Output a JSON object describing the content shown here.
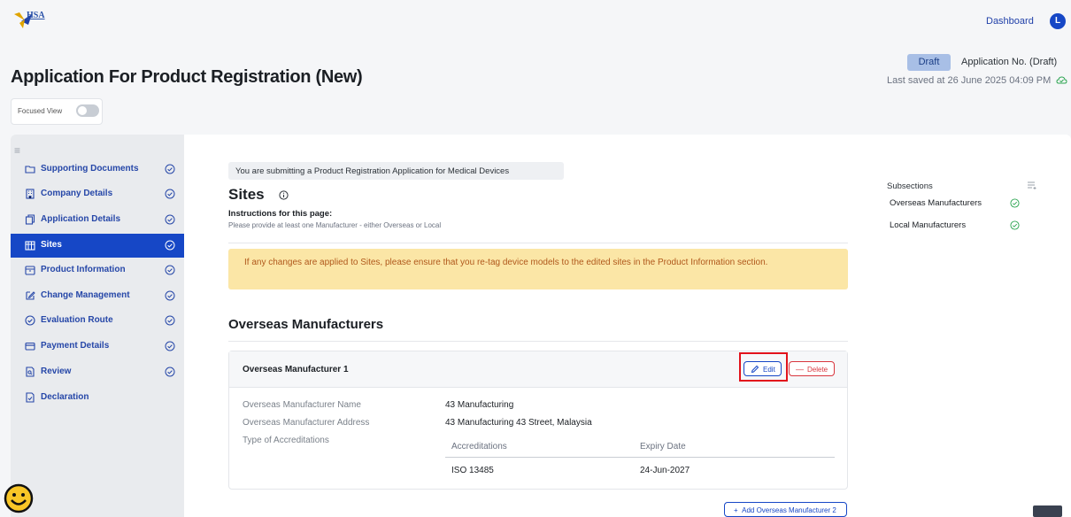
{
  "header": {
    "logo_text": "HSA",
    "dashboard_link": "Dashboard",
    "avatar_initial": "L",
    "page_title": "Application For Product Registration (New)",
    "status_badge": "Draft",
    "application_no": "Application No. (Draft)",
    "last_saved": "Last saved at 26 June 2025 04:09 PM",
    "focused_view_label": "Focused View",
    "focused_view_on": false
  },
  "sidebar": {
    "items": [
      {
        "label": "Supporting Documents",
        "icon": "folder-icon",
        "done": true
      },
      {
        "label": "Company Details",
        "icon": "building-icon",
        "done": true
      },
      {
        "label": "Application Details",
        "icon": "copy-icon",
        "done": true
      },
      {
        "label": "Sites",
        "icon": "sites-icon",
        "done": true,
        "active": true
      },
      {
        "label": "Product Information",
        "icon": "box-icon",
        "done": true
      },
      {
        "label": "Change Management",
        "icon": "edit-icon",
        "done": true
      },
      {
        "label": "Evaluation Route",
        "icon": "check-circle-icon",
        "done": true
      },
      {
        "label": "Payment Details",
        "icon": "card-icon",
        "done": true
      },
      {
        "label": "Review",
        "icon": "review-icon",
        "done": true
      },
      {
        "label": "Declaration",
        "icon": "document-icon",
        "done": false
      }
    ]
  },
  "main": {
    "notice": "You are submitting a Product Registration Application for Medical Devices",
    "title": "Sites",
    "instructions_title": "Instructions for this page:",
    "instructions_text": "Please provide at least one Manufacturer - either Overseas or Local",
    "warning_text": "If any changes are applied to Sites, please ensure that you re-tag device models to the edited sites in the Product Information section.",
    "section_title": "Overseas Manufacturers",
    "card": {
      "title": "Overseas Manufacturer 1",
      "edit_label": "Edit",
      "delete_label": "Delete",
      "fields": [
        {
          "key": "Overseas Manufacturer Name",
          "value": "43 Manufacturing"
        },
        {
          "key": "Overseas Manufacturer Address",
          "value": "43 Manufacturing 43 Street, Malaysia"
        },
        {
          "key": "Type of Accreditations",
          "value": ""
        }
      ],
      "accreditations": {
        "headers": [
          "Accreditations",
          "Expiry Date"
        ],
        "rows": [
          [
            "ISO 13485",
            "24-Jun-2027"
          ]
        ]
      }
    },
    "add_button": "Add Overseas Manufacturer 2"
  },
  "subsections": {
    "title": "Subsections",
    "items": [
      {
        "label": "Overseas Manufacturers",
        "done": true
      },
      {
        "label": "Local Manufacturers",
        "done": true
      }
    ]
  },
  "colors": {
    "primary": "#1647c6",
    "warning_bg": "#fbe6a6",
    "warning_text": "#b0581b",
    "success": "#2aa44f",
    "danger": "#d9363e"
  }
}
